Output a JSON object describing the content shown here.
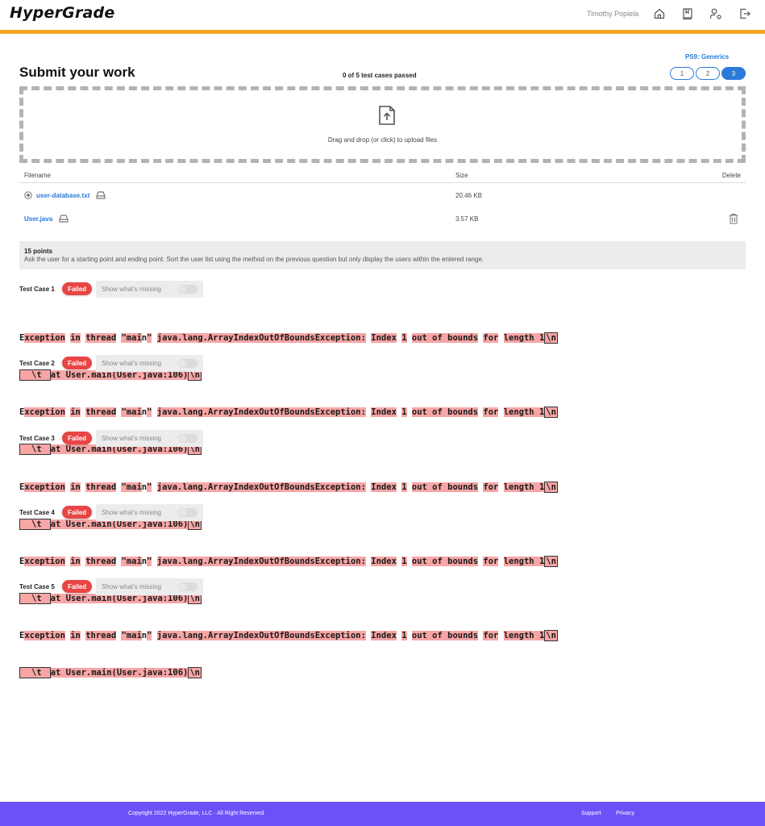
{
  "header": {
    "logo": "HyperGrade",
    "user_name": "Timothy Popiela",
    "icons": [
      "home-icon",
      "book-icon",
      "user-settings-icon",
      "logout-icon"
    ],
    "accent_color": "#f5a623"
  },
  "page": {
    "title": "Submit your work",
    "pass_summary": "0 of 5 test cases passed",
    "problem_set": "PS9: Generics",
    "questions": [
      {
        "label": "1",
        "active": false
      },
      {
        "label": "2",
        "active": false
      },
      {
        "label": "3",
        "active": true
      }
    ]
  },
  "dropzone": {
    "icon": "file-upload-icon",
    "text": "Drag and drop (or click) to upload files"
  },
  "files": {
    "headers": {
      "filename": "Filename",
      "size": "Size",
      "delete": "Delete"
    },
    "rows": [
      {
        "name": "user-database.txt",
        "size": "20.46 KB",
        "has_radio": true,
        "deletable": false
      },
      {
        "name": "User.java",
        "size": "3.57 KB",
        "has_radio": false,
        "deletable": true
      }
    ]
  },
  "prompt": {
    "points": "15 points",
    "description": "Ask the user for a starting point and ending point. Sort the user list using the method on the previous question but only display the users within the entered range."
  },
  "test_cases": [
    {
      "label": "Test Case 1",
      "status": "Failed",
      "toggle_label": "Show what's missing",
      "toggle_on": false
    },
    {
      "label": "Test Case 2",
      "status": "Failed",
      "toggle_label": "Show what's missing",
      "toggle_on": false
    },
    {
      "label": "Test Case 3",
      "status": "Failed",
      "toggle_label": "Show what's missing",
      "toggle_on": false
    },
    {
      "label": "Test Case 4",
      "status": "Failed",
      "toggle_label": "Show what's missing",
      "toggle_on": false
    },
    {
      "label": "Test Case 5",
      "status": "Failed",
      "toggle_label": "Show what's missing",
      "toggle_on": false
    }
  ],
  "output": {
    "line1_tokens": [
      "E",
      "xception",
      " ",
      "in",
      " ",
      "thread",
      " ",
      "\"mai",
      "n",
      "\"",
      " ",
      "java.lang.ArrayIndexOutOfBoundsException:",
      " ",
      "Index",
      " ",
      "1",
      " ",
      "out of bounds",
      " ",
      "for",
      " ",
      "length 1"
    ],
    "newline_marker": "\\n",
    "tab_marker": "\\t",
    "line2_text": "at User.main(User.java:106)"
  },
  "footer": {
    "copyright": "Copyright 2022 HyperGrade, LLC · All Right Reserved",
    "links": [
      "Support",
      "Privacy"
    ],
    "color": "#6b52f7"
  }
}
